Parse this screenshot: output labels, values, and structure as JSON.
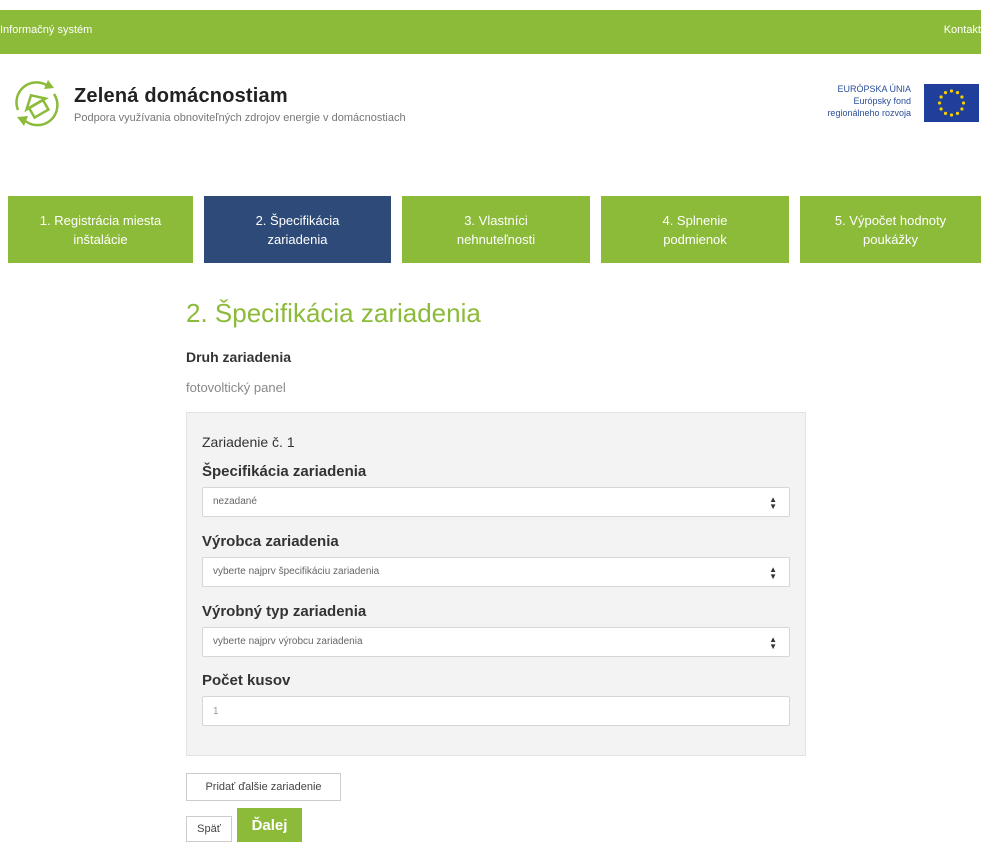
{
  "topbar": {
    "system_link": "Informačný systém",
    "contact_link": "Kontakt"
  },
  "brand": {
    "title": "Zelená domácnostiam",
    "subtitle": "Podpora využívania obnoviteľných zdrojov energie v domácnostiach",
    "logo_icon": "house-cycle-logo-icon"
  },
  "eu": {
    "lines": [
      "EURÓPSKA ÚNIA",
      "Európsky fond",
      "regionálneho rozvoja"
    ],
    "flag_icon": "eu-flag-icon"
  },
  "steps": [
    {
      "label": "1. Registrácia miesta\ninštalácie",
      "active": false
    },
    {
      "label": "2. Špecifikácia\nzariadenia",
      "active": true
    },
    {
      "label": "3. Vlastníci\nnehnuteľnosti",
      "active": false
    },
    {
      "label": "4. Splnenie\npodmienok",
      "active": false
    },
    {
      "label": "5. Výpočet hodnoty\npoukážky",
      "active": false
    }
  ],
  "form": {
    "heading": "2. Špecifikácia zariadenia",
    "device_type_label": "Druh zariadenia",
    "device_type_value": "fotovoltický panel",
    "panel_title": "Zariadenie č. 1",
    "spec_label": "Špecifikácia zariadenia",
    "spec_value": "nezadané",
    "manufacturer_label": "Výrobca zariadenia",
    "manufacturer_value": "vyberte najprv špecifikáciu zariadenia",
    "model_label": "Výrobný typ zariadenia",
    "model_value": "vyberte najprv výrobcu zariadenia",
    "count_label": "Počet kusov",
    "count_value": "1"
  },
  "buttons": {
    "add_device": "Pridať ďalšie zariadenie",
    "back": "Späť",
    "next": "Ďalej"
  },
  "colors": {
    "green": "#8cbb3a",
    "navy": "#2e4a78",
    "panel_bg": "#f3f3f3"
  }
}
